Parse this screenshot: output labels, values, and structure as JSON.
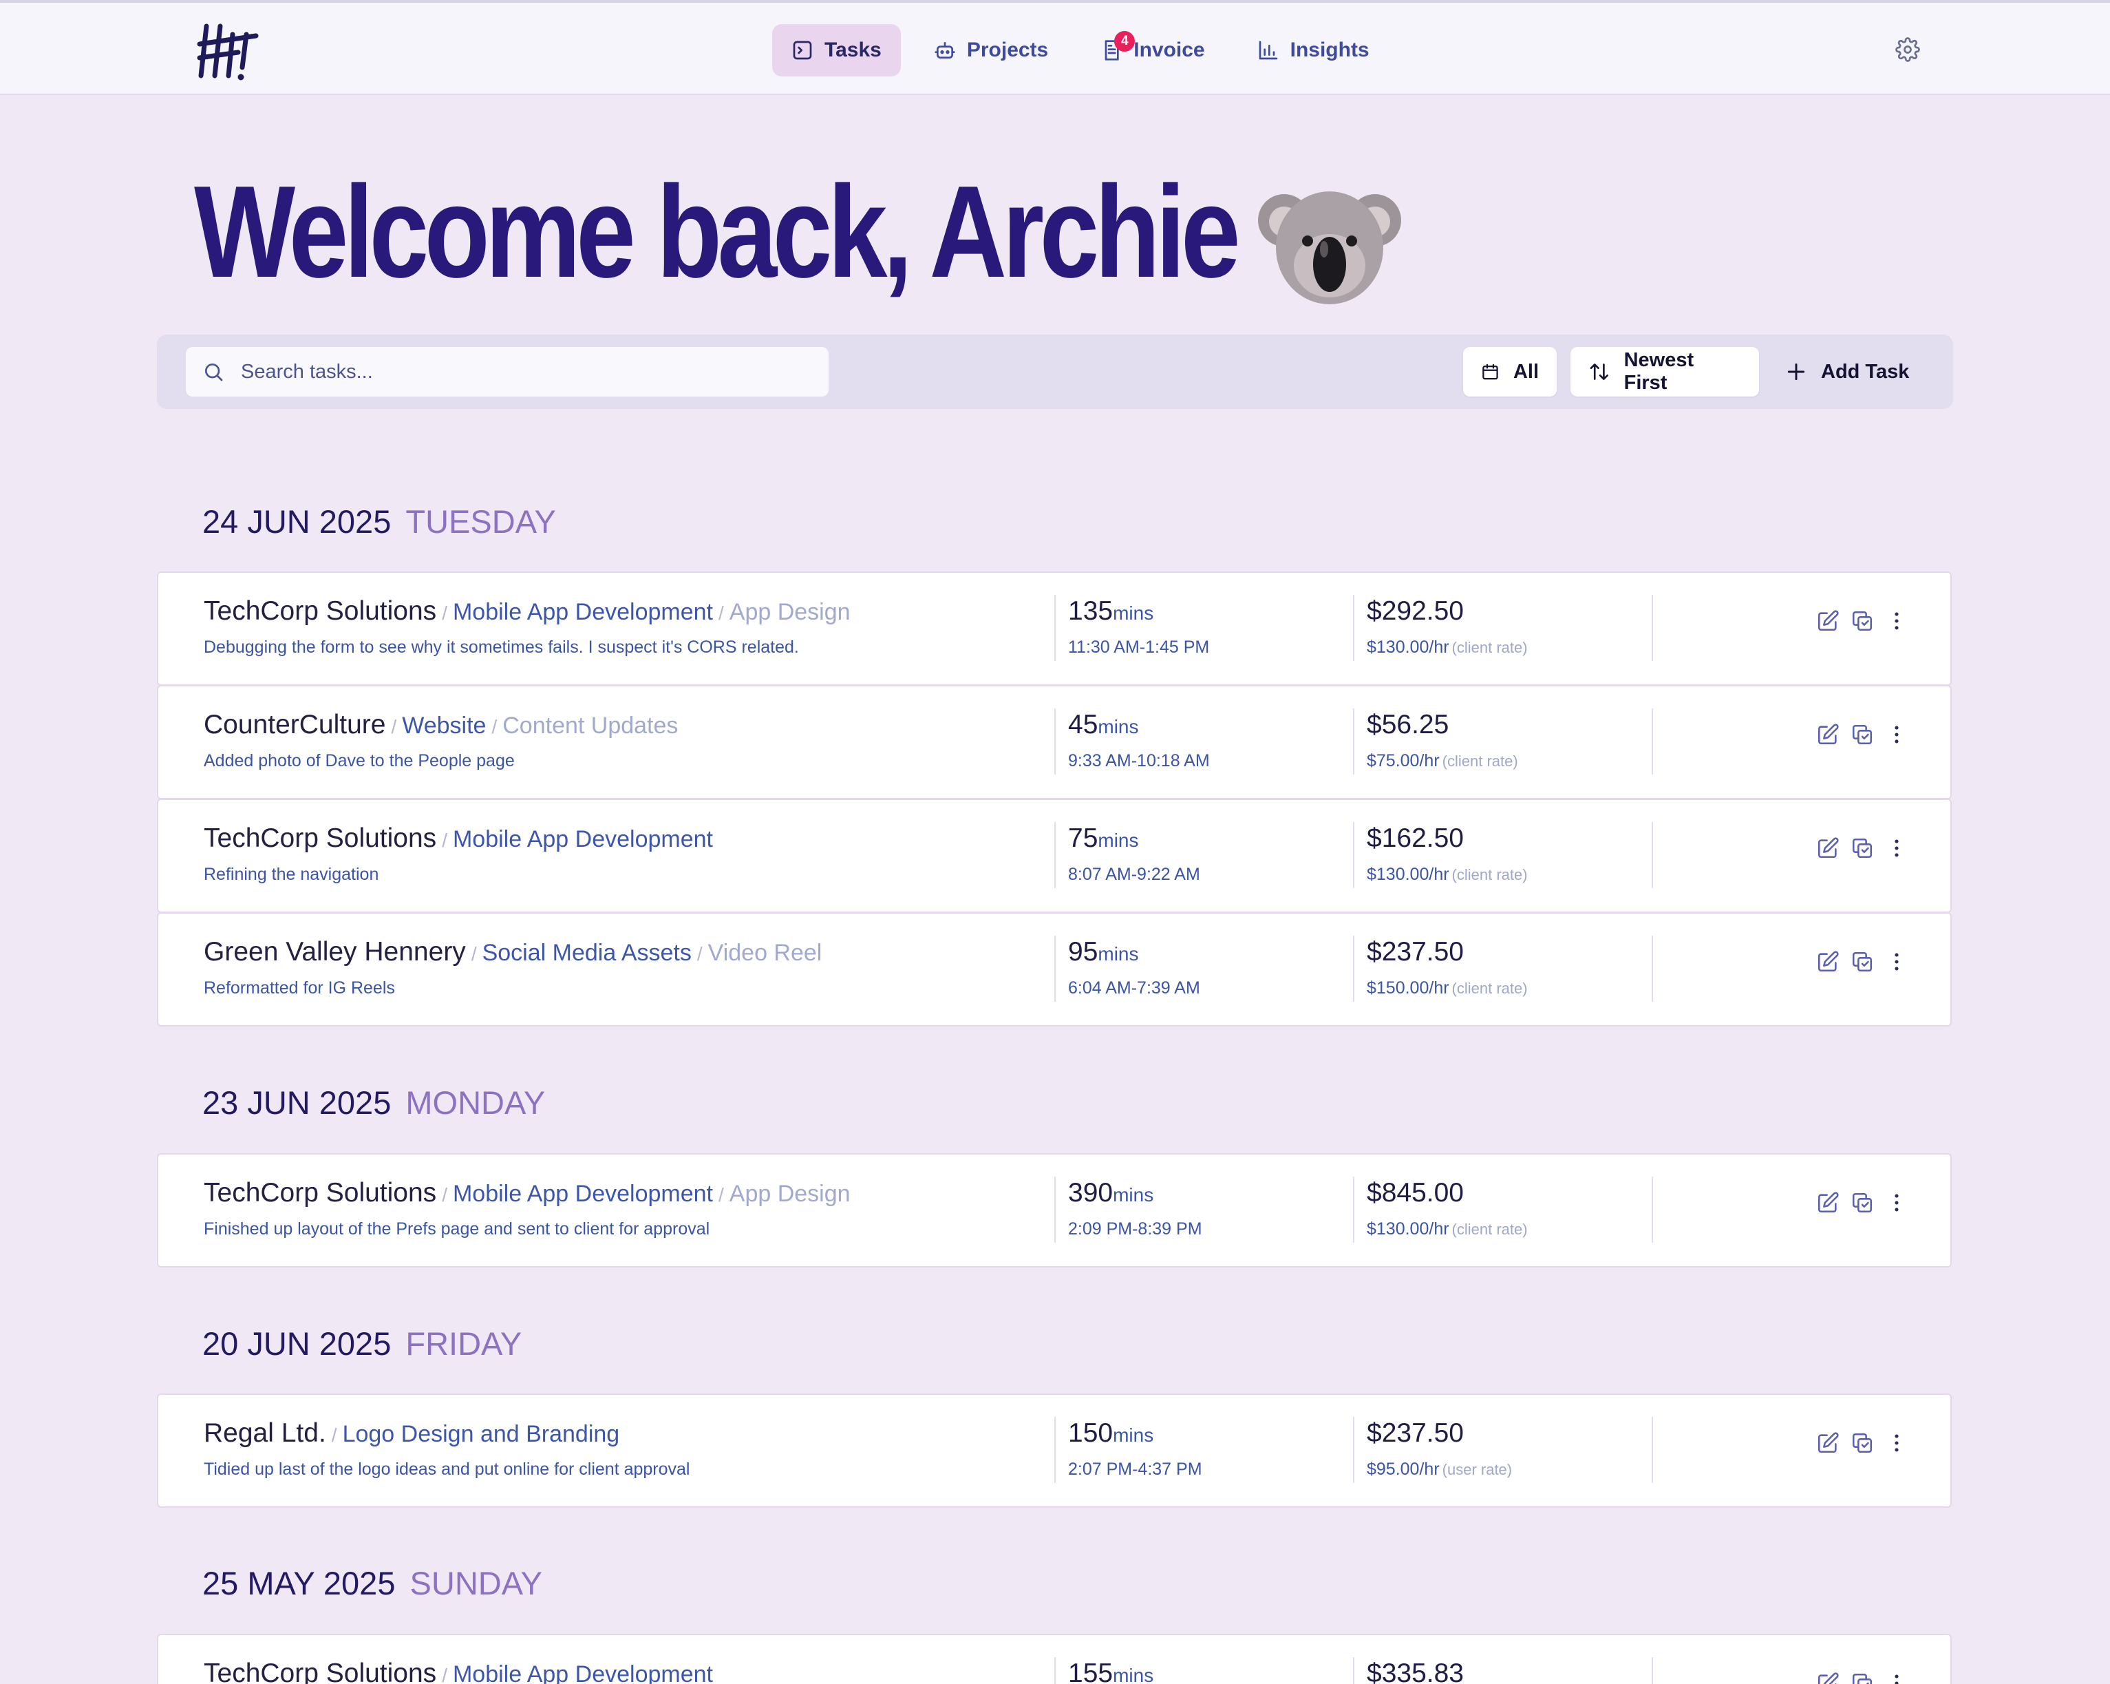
{
  "nav": {
    "items": [
      {
        "label": "Tasks",
        "icon": "tasks-icon",
        "active": true
      },
      {
        "label": "Projects",
        "icon": "robot-icon",
        "active": false
      },
      {
        "label": "Invoice",
        "icon": "invoice-icon",
        "active": false,
        "badge": "4"
      },
      {
        "label": "Insights",
        "icon": "bar-chart-icon",
        "active": false
      }
    ],
    "settings_icon": "gear-icon"
  },
  "welcome": "Welcome back, Archie",
  "toolbar": {
    "search_placeholder": "Search tasks...",
    "filter_label": "All",
    "sort_label": "Newest First",
    "add_label": "Add Task"
  },
  "colors": {
    "background": "#f1e8f5",
    "heading": "#28197a",
    "accent": "#3c56ad",
    "badge": "#e8215c",
    "active_tab": "#ead5ef"
  },
  "groups": [
    {
      "date": "24 JUN 2025",
      "day": "TUESDAY",
      "tasks": [
        {
          "client": "TechCorp Solutions",
          "project": "Mobile App Development",
          "subtask": "App Design",
          "description": "Debugging the form to see why it sometimes fails. I suspect it's CORS related.",
          "mins": "135",
          "unit": "mins",
          "time_range": "11:30 AM-1:45 PM",
          "amount": "$292.50",
          "rate": "$130.00/hr",
          "rate_type": "(client rate)"
        },
        {
          "client": "CounterCulture",
          "project": "Website",
          "subtask": "Content Updates",
          "description": "Added photo of Dave to the People page",
          "mins": "45",
          "unit": "mins",
          "time_range": "9:33 AM-10:18 AM",
          "amount": "$56.25",
          "rate": "$75.00/hr",
          "rate_type": "(client rate)"
        },
        {
          "client": "TechCorp Solutions",
          "project": "Mobile App Development",
          "subtask": "",
          "description": "Refining the navigation",
          "mins": "75",
          "unit": "mins",
          "time_range": "8:07 AM-9:22 AM",
          "amount": "$162.50",
          "rate": "$130.00/hr",
          "rate_type": "(client rate)"
        },
        {
          "client": "Green Valley Hennery",
          "project": "Social Media Assets",
          "subtask": "Video Reel",
          "description": "Reformatted for IG Reels",
          "mins": "95",
          "unit": "mins",
          "time_range": "6:04 AM-7:39 AM",
          "amount": "$237.50",
          "rate": "$150.00/hr",
          "rate_type": "(client rate)"
        }
      ]
    },
    {
      "date": "23 JUN 2025",
      "day": "MONDAY",
      "tasks": [
        {
          "client": "TechCorp Solutions",
          "project": "Mobile App Development",
          "subtask": "App Design",
          "description": "Finished up layout of the Prefs page and sent to client for approval",
          "mins": "390",
          "unit": "mins",
          "time_range": "2:09 PM-8:39 PM",
          "amount": "$845.00",
          "rate": "$130.00/hr",
          "rate_type": "(client rate)"
        }
      ]
    },
    {
      "date": "20 JUN 2025",
      "day": "FRIDAY",
      "tasks": [
        {
          "client": "Regal Ltd.",
          "project": "Logo Design and Branding",
          "subtask": "",
          "description": "Tidied up last of the logo ideas and put online for client approval",
          "mins": "150",
          "unit": "mins",
          "time_range": "2:07 PM-4:37 PM",
          "amount": "$237.50",
          "rate": "$95.00/hr",
          "rate_type": "(user rate)"
        }
      ]
    },
    {
      "date": "25 MAY 2025",
      "day": "SUNDAY",
      "tasks": [
        {
          "client": "TechCorp Solutions",
          "project": "Mobile App Development",
          "subtask": "",
          "description": "",
          "mins": "155",
          "unit": "mins",
          "time_range": "",
          "amount": "$335.83",
          "rate": "",
          "rate_type": ""
        }
      ]
    }
  ]
}
